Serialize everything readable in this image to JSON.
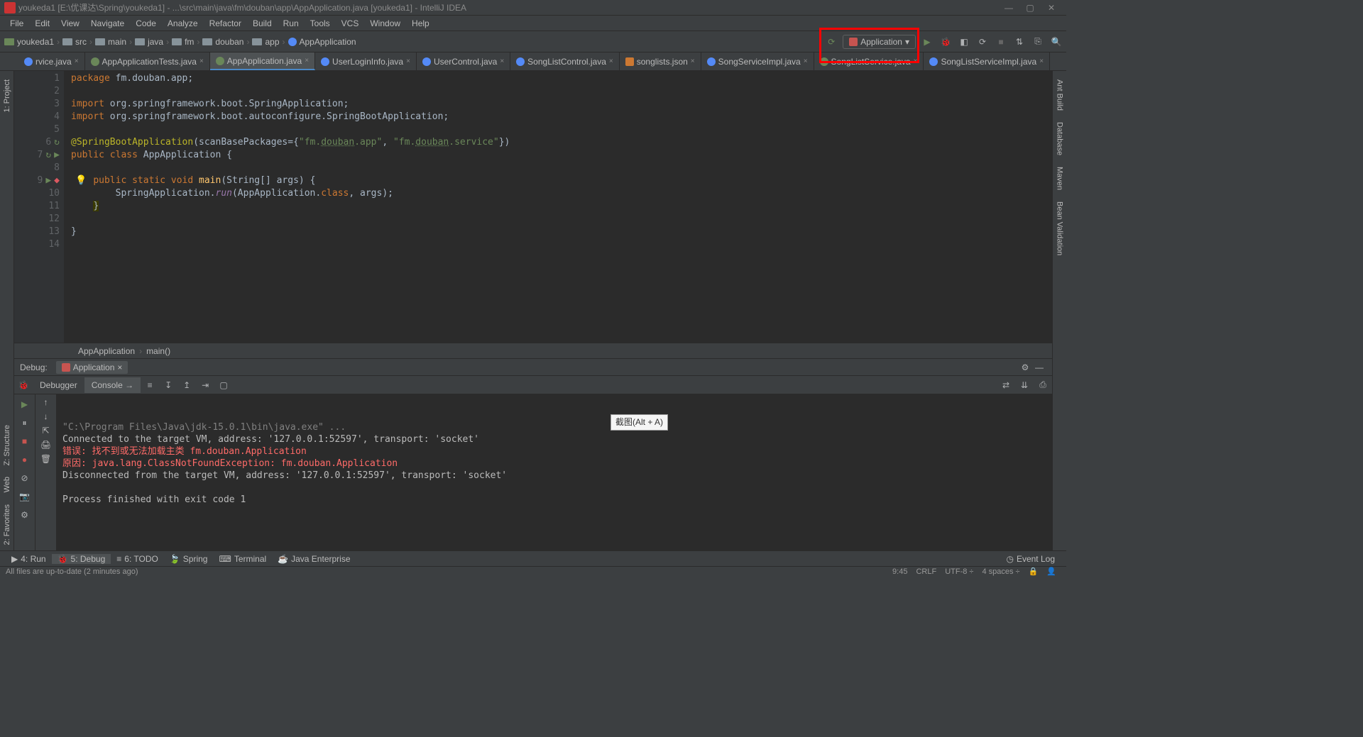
{
  "window": {
    "title": "youkeda1 [E:\\优课达\\Spring\\youkeda1] - ...\\src\\main\\java\\fm\\douban\\app\\AppApplication.java [youkeda1] - IntelliJ IDEA"
  },
  "menu": {
    "file": "File",
    "edit": "Edit",
    "view": "View",
    "navigate": "Navigate",
    "code": "Code",
    "analyze": "Analyze",
    "refactor": "Refactor",
    "build": "Build",
    "run": "Run",
    "tools": "Tools",
    "vcs": "VCS",
    "window": "Window",
    "help": "Help"
  },
  "breadcrumb": [
    "youkeda1",
    "src",
    "main",
    "java",
    "fm",
    "douban",
    "app",
    "AppApplication"
  ],
  "runconfig": {
    "label": "Application"
  },
  "tabs": [
    {
      "label": "rvice.java",
      "icon": "blue"
    },
    {
      "label": "AppApplicationTests.java",
      "icon": "green"
    },
    {
      "label": "AppApplication.java",
      "icon": "green",
      "active": true
    },
    {
      "label": "UserLoginInfo.java",
      "icon": "blue"
    },
    {
      "label": "UserControl.java",
      "icon": "blue"
    },
    {
      "label": "SongListControl.java",
      "icon": "blue"
    },
    {
      "label": "songlists.json",
      "icon": "json"
    },
    {
      "label": "SongServiceImpl.java",
      "icon": "blue"
    },
    {
      "label": "SongListService.java",
      "icon": "green"
    },
    {
      "label": "SongListServiceImpl.java",
      "icon": "blue"
    }
  ],
  "sidebars": {
    "left": [
      "1: Project"
    ],
    "left_bottom": [
      "Web",
      "2: Favorites",
      "Z: Structure"
    ],
    "right": [
      "Ant Build",
      "Database",
      "Maven",
      "Bean Validation"
    ]
  },
  "code": {
    "lines": [
      {
        "n": 1,
        "html": "<span class='kw'>package</span> fm.douban.app;"
      },
      {
        "n": 2,
        "html": ""
      },
      {
        "n": 3,
        "html": "<span class='kw'>import</span> org.springframework.boot.SpringApplication;"
      },
      {
        "n": 4,
        "html": "<span class='kw'>import</span> org.springframework.boot.autoconfigure.<span class='cls'>SpringBootApplication</span>;"
      },
      {
        "n": 5,
        "html": ""
      },
      {
        "n": 6,
        "html": "<span class='ann'>@SpringBootApplication</span>(scanBasePackages={<span class='str'>\"fm.<span class='ul'>douban</span>.app\"</span>, <span class='str'>\"fm.<span class='ul'>douban</span>.service\"</span>})"
      },
      {
        "n": 7,
        "html": "<span class='kw'>public class</span> AppApplication {"
      },
      {
        "n": 8,
        "html": ""
      },
      {
        "n": 9,
        "html": "    <span class='kw'>public static void</span> <span class='fn'>main</span>(String[] args) {"
      },
      {
        "n": 10,
        "html": "        SpringApplication.<span class='it'>run</span>(AppApplication.<span class='kw'>class</span>, args);"
      },
      {
        "n": 11,
        "html": "    <span style='background:#3a3a00'>}</span>"
      },
      {
        "n": 12,
        "html": ""
      },
      {
        "n": 13,
        "html": "}"
      },
      {
        "n": 14,
        "html": ""
      }
    ]
  },
  "breadcrumb2": [
    "AppApplication",
    "main()"
  ],
  "debug": {
    "title": "Debug:",
    "apptab": "Application",
    "subtabs": {
      "debugger": "Debugger",
      "console": "Console"
    },
    "console_lines": [
      {
        "cls": "gray",
        "text": "\"C:\\Program Files\\Java\\jdk-15.0.1\\bin\\java.exe\" ..."
      },
      {
        "cls": "",
        "text": "Connected to the target VM, address: '127.0.0.1:52597', transport: 'socket'"
      },
      {
        "cls": "red",
        "text": "错误: 找不到或无法加载主类 fm.douban.Application"
      },
      {
        "cls": "red",
        "text": "原因: java.lang.ClassNotFoundException: fm.douban.Application"
      },
      {
        "cls": "",
        "text": "Disconnected from the target VM, address: '127.0.0.1:52597', transport: 'socket'"
      },
      {
        "cls": "",
        "text": ""
      },
      {
        "cls": "",
        "text": "Process finished with exit code 1"
      }
    ]
  },
  "tooltip": "截图(Alt + A)",
  "bottombar": {
    "items": [
      "4: Run",
      "5: Debug",
      "6: TODO",
      "Spring",
      "Terminal",
      "Java Enterprise"
    ],
    "eventlog": "Event Log"
  },
  "statusbar": {
    "msg": "All files are up-to-date (2 minutes ago)",
    "pos": "9:45",
    "crlf": "CRLF",
    "enc": "UTF-8",
    "indent": "4 spaces"
  }
}
